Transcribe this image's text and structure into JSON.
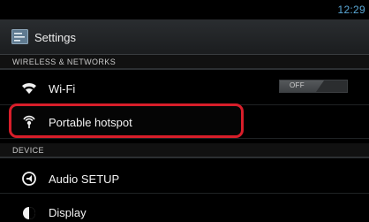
{
  "status_bar": {
    "time": "12:29"
  },
  "action_bar": {
    "title": "Settings"
  },
  "sections": {
    "wireless": {
      "header": "WIRELESS & NETWORKS",
      "wifi": {
        "label": "Wi-Fi",
        "toggle": "OFF"
      },
      "hotspot": {
        "label": "Portable hotspot"
      }
    },
    "device": {
      "header": "DEVICE",
      "audio": {
        "label": "Audio SETUP"
      },
      "display": {
        "label": "Display"
      }
    }
  },
  "colors": {
    "accent": "#5aa8d6",
    "highlight": "#d81e2a",
    "background": "#000000"
  },
  "icons": [
    "settings-icon",
    "wifi-icon",
    "hotspot-icon",
    "audio-icon",
    "display-icon"
  ]
}
